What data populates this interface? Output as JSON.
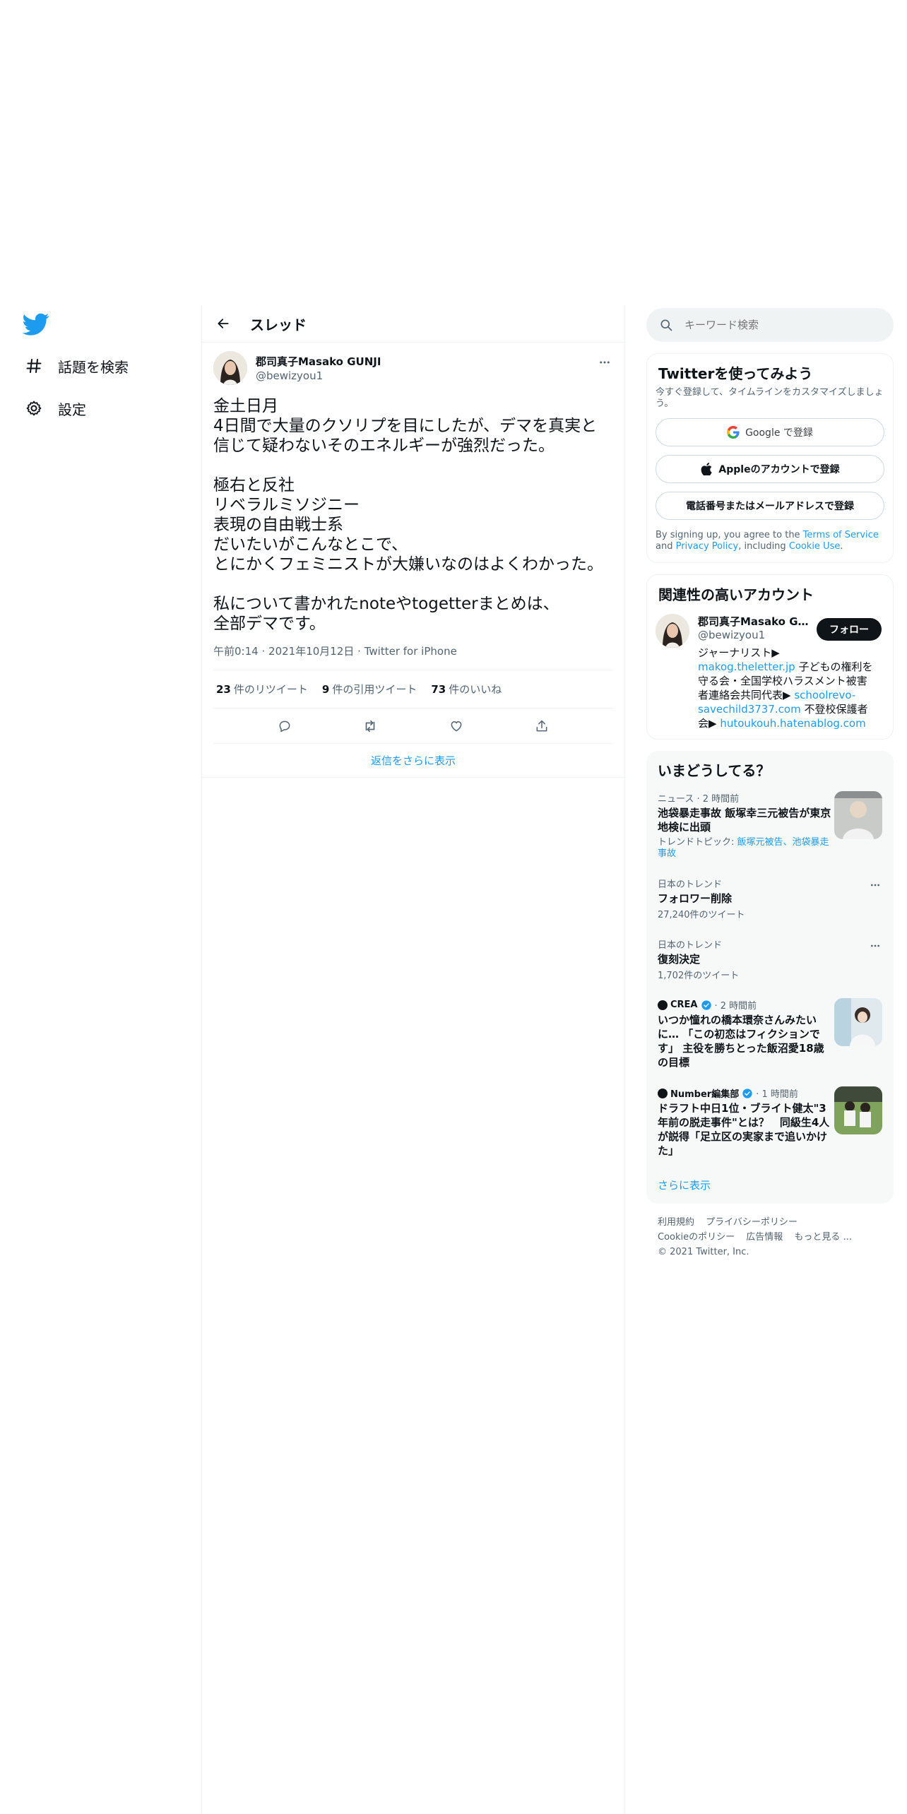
{
  "nav": {
    "items": [
      {
        "label": "話題を検索",
        "icon": "hashtag-icon"
      },
      {
        "label": "設定",
        "icon": "gear-icon"
      }
    ]
  },
  "thread": {
    "title": "スレッド",
    "tweet": {
      "author_name": "郡司真子Masako GUNJI",
      "author_handle": "@bewizyou1",
      "lines": [
        "金土日月",
        "4日間で大量のクソリプを目にしたが、デマを真実と信じて疑わないそのエネルギーが強烈だった。",
        "",
        "極右と反社",
        "リベラルミソジニー",
        "表現の自由戦士系",
        "だいたいがこんなとこで、",
        "とにかくフェミニストが大嫌いなのはよくわかった。",
        "",
        "私について書かれたnoteやtogetterまとめは、",
        "全部デマです。"
      ],
      "time": "午前0:14",
      "date": "2021年10月12日",
      "source": "Twitter for iPhone",
      "sep": "·",
      "retweets_num": "23",
      "retweets_label": "件のリツイート",
      "quotes_num": "9",
      "quotes_label": "件の引用ツイート",
      "likes_num": "73",
      "likes_label": "件のいいね"
    },
    "show_more_replies": "返信をさらに表示"
  },
  "search": {
    "placeholder": "キーワード検索"
  },
  "signup": {
    "title": "Twitterを使ってみよう",
    "subtitle": "今すぐ登録して、タイムラインをカスタマイズしましょう。",
    "google_label": "Google で登録",
    "apple_label": "Appleのアカウントで登録",
    "phone_label": "電話番号またはメールアドレスで登録",
    "terms_prefix": "By signing up, you agree to the ",
    "terms_link": "Terms of Service",
    "terms_and": " and ",
    "privacy_link": "Privacy Policy",
    "terms_including": ", including ",
    "cookie_link": "Cookie Use",
    "terms_end": "."
  },
  "related": {
    "title": "関連性の高いアカウント",
    "name": "郡司真子Masako GUNJI",
    "handle": "@bewizyou1",
    "follow_label": "フォロー",
    "bio_1": "ジャーナリスト▶ ",
    "bio_link_1": "makog.theletter.jp",
    "bio_2": " 子どもの権利を守る会・全国学校ハラスメント被害者連絡会共同代表▶ ",
    "bio_link_2": "schoolrevo-savechild3737.com",
    "bio_3": " 不登校保護者会▶ ",
    "bio_link_3": "hutoukouh.hatenablog.com"
  },
  "trends": {
    "title": "いまどうしてる？",
    "items": [
      {
        "context": "ニュース · 2 時間前",
        "title": "池袋暴走事故 飯塚幸三元被告が東京地検に出頭",
        "topics_prefix": "トレンドトピック: ",
        "topics_link": "飯塚元被告、池袋暴走事故"
      },
      {
        "context": "日本のトレンド",
        "title": "フォロワー削除",
        "count": "27,240件のツイート"
      },
      {
        "context": "日本のトレンド",
        "title": "復刻決定",
        "count": "1,702件のツイート"
      },
      {
        "source": "CREA",
        "time": "· 2 時間前",
        "title": "いつか憧れの橋本環奈さんみたいに… 「この初恋はフィクションです」 主役を勝ちとった飯沼愛18歳の目標"
      },
      {
        "source": "Number編集部",
        "time": "· 1 時間前",
        "title": "ドラフト中日1位・ブライト健太\"3年前の脱走事件\"とは？　同級生4人が説得「足立区の実家まで追いかけた」"
      }
    ],
    "show_more": "さらに表示"
  },
  "footer": {
    "terms": "利用規約",
    "privacy": "プライバシーポリシー",
    "cookie": "Cookieのポリシー",
    "ads": "広告情報",
    "more": "もっと見る ...",
    "copyright": "© 2021 Twitter, Inc."
  },
  "colors": {
    "accent": "#1d9bf0",
    "text": "#0f1419",
    "muted": "#536471",
    "border": "#eff3f4"
  }
}
